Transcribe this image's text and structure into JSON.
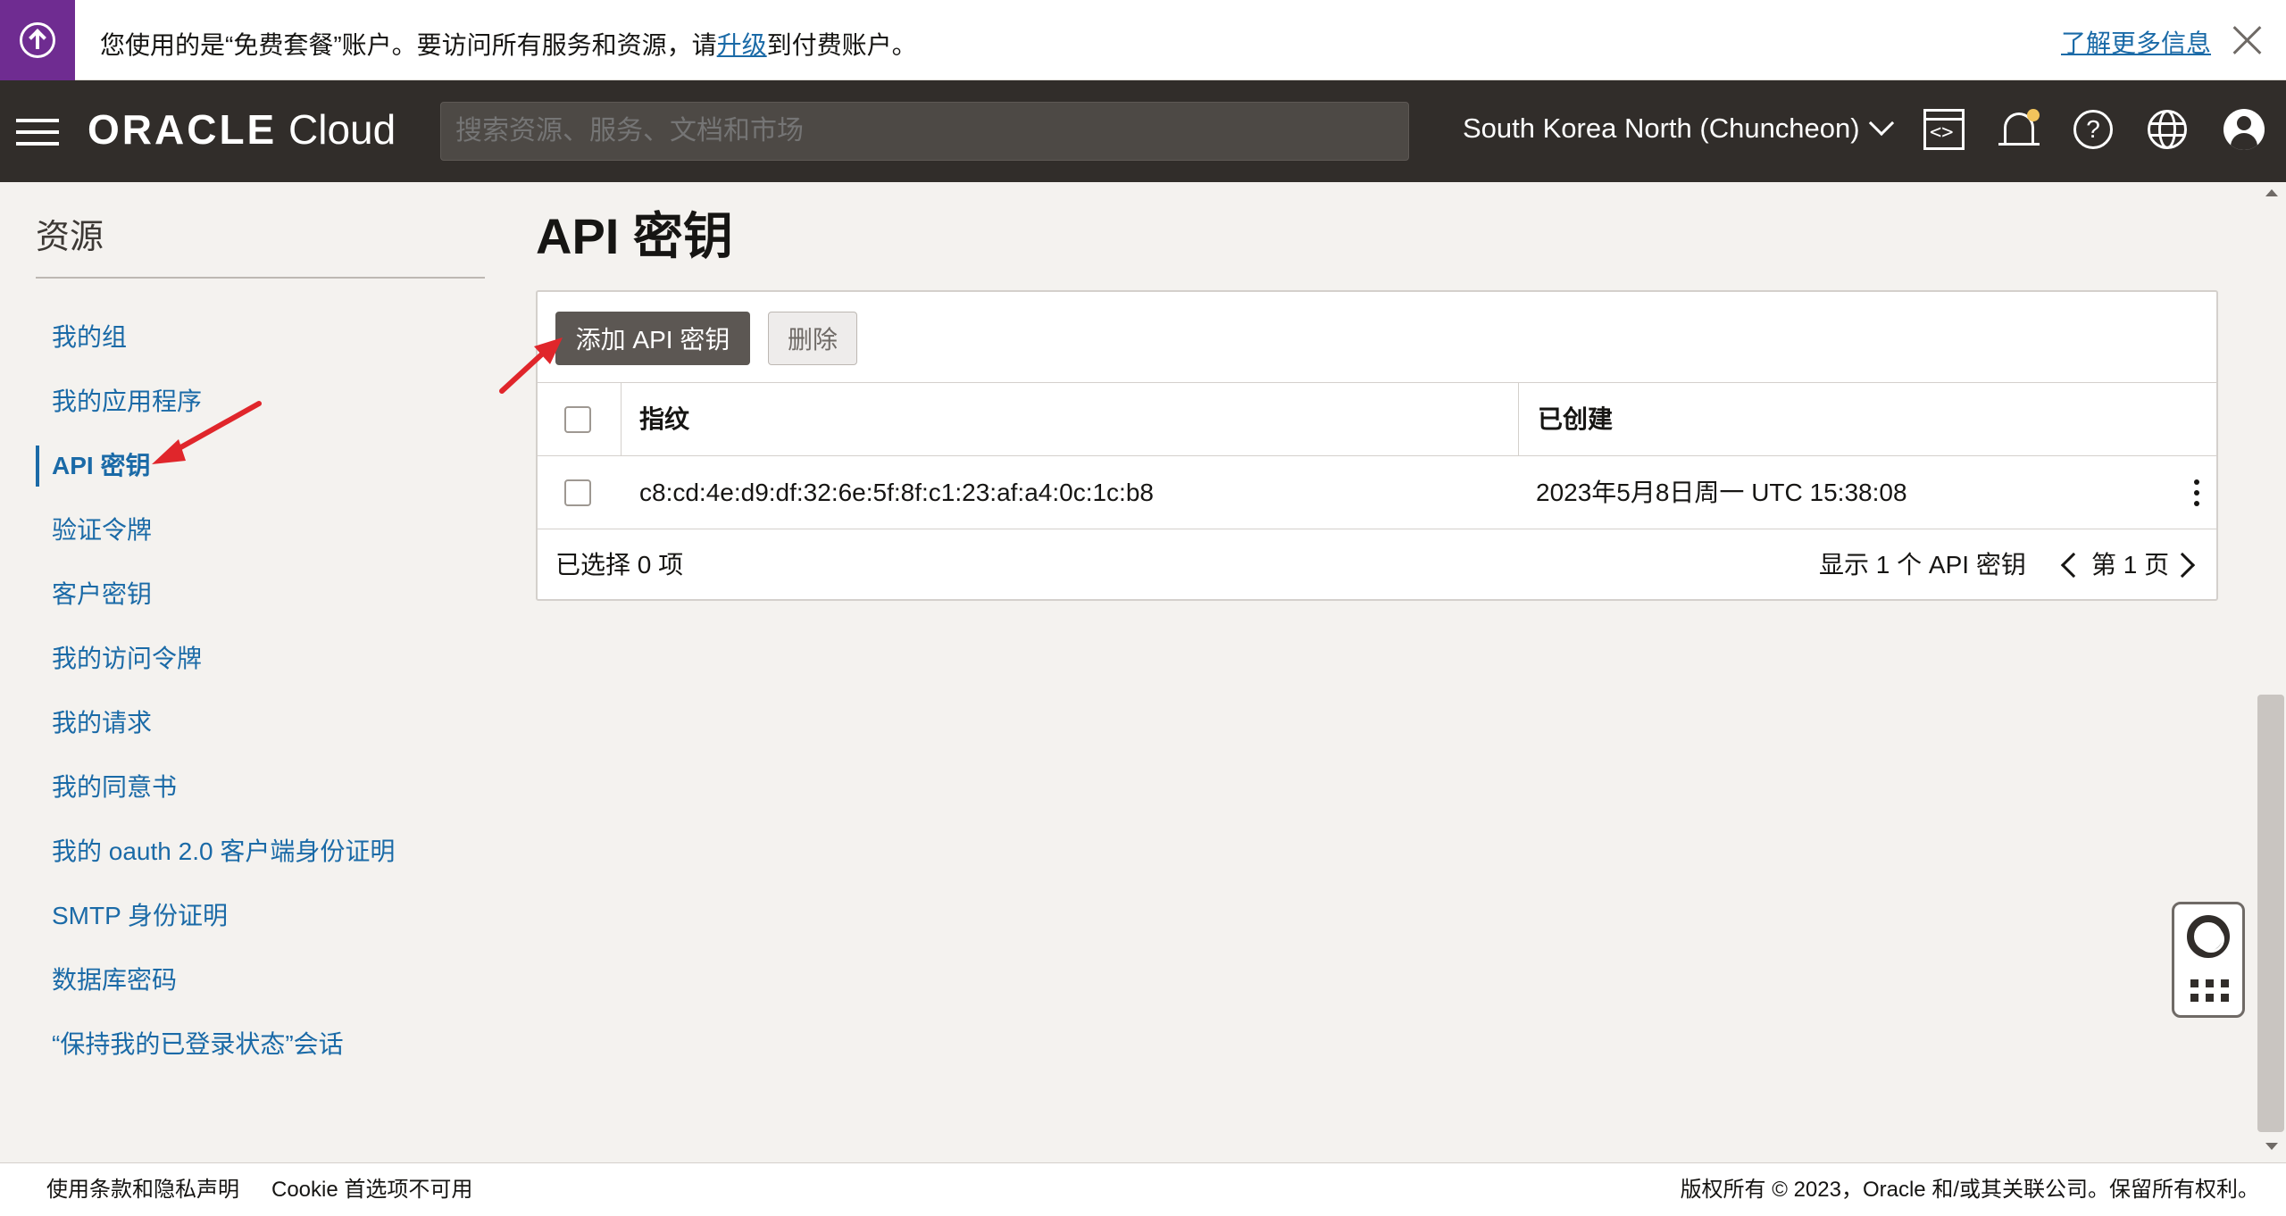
{
  "banner": {
    "text_before": "您使用的是“免费套餐”账户。要访问所有服务和资源，请",
    "upgrade_link": "升级",
    "text_after": "到付费账户。",
    "more_info": "了解更多信息"
  },
  "header": {
    "logo_brand": "ORACLE",
    "logo_product": "Cloud",
    "search_placeholder": "搜索资源、服务、文档和市场",
    "region": "South Korea North (Chuncheon)",
    "code_editor_glyph": "<>",
    "help_glyph": "?"
  },
  "sidebar": {
    "title": "资源",
    "items": [
      {
        "label": "我的组"
      },
      {
        "label": "我的应用程序"
      },
      {
        "label": "API 密钥",
        "active": true
      },
      {
        "label": "验证令牌"
      },
      {
        "label": "客户密钥"
      },
      {
        "label": "我的访问令牌"
      },
      {
        "label": "我的请求"
      },
      {
        "label": "我的同意书"
      },
      {
        "label": "我的 oauth 2.0 客户端身份证明"
      },
      {
        "label": "SMTP 身份证明"
      },
      {
        "label": "数据库密码"
      },
      {
        "label": "“保持我的已登录状态”会话"
      }
    ]
  },
  "main": {
    "title": "API 密钥",
    "add_button": "添加 API 密钥",
    "delete_button": "删除",
    "columns": [
      "指纹",
      "已创建"
    ],
    "rows": [
      {
        "fingerprint": "c8:cd:4e:d9:df:32:6e:5f:8f:c1:23:af:a4:0c:1c:b8",
        "created": "2023年5月8日周一 UTC 15:38:08"
      }
    ],
    "selected_count": "已选择 0 项",
    "showing": "显示 1 个 API 密钥",
    "page": "第 1 页"
  },
  "footer": {
    "terms": "使用条款和隐私声明",
    "cookie": "Cookie 首选项不可用",
    "copyright": "版权所有 © 2023，Oracle 和/或其关联公司。保留所有权利。"
  },
  "colors": {
    "banner_accent": "#6f2c91",
    "header_bg": "#312d2a",
    "link": "#1a6aa7",
    "annotation_arrow": "#e0262b"
  }
}
